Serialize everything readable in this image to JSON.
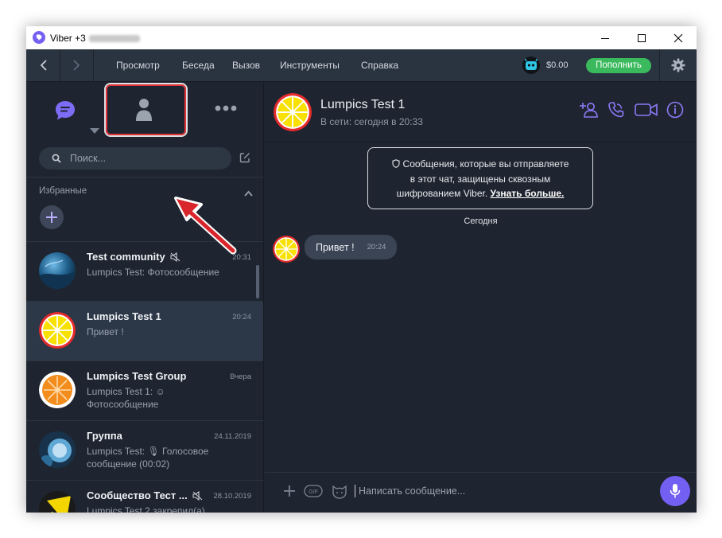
{
  "window": {
    "title": "Viber +3",
    "controls": {
      "minimize": "minimize",
      "maximize": "maximize",
      "close": "close"
    }
  },
  "menubar": {
    "items": [
      "Просмотр",
      "Беседа",
      "Вызов",
      "Инструменты",
      "Справка"
    ],
    "balance": "$0.00",
    "topup_label": "Пополнить"
  },
  "sidebar": {
    "search_placeholder": "Поиск...",
    "favorites_label": "Избранные",
    "chats": [
      {
        "name": "Test community",
        "time": "20:31",
        "preview": "Lumpics Test: Фотосообщение",
        "muted": true,
        "avatar": "community-photo"
      },
      {
        "name": "Lumpics Test 1",
        "time": "20:24",
        "preview": "Привет !",
        "muted": false,
        "avatar": "lemon"
      },
      {
        "name": "Lumpics Test Group",
        "time": "Вчера",
        "preview_line1": "Lumpics Test 1: ☺",
        "preview_line2": "Фотосообщение",
        "muted": false,
        "avatar": "orange"
      },
      {
        "name": "Группа",
        "time": "24.11.2019",
        "preview_line1": "Lumpics Test: 🎙 Голосовое",
        "preview_line2": "сообщение (00:02)",
        "muted": false,
        "avatar": "group-photo"
      },
      {
        "name": "Сообщество Тест ...",
        "time": "28.10.2019",
        "preview": "Lumpics Test 2 закрепил(а)",
        "muted": true,
        "avatar": "community-yellow"
      }
    ]
  },
  "conversation": {
    "name": "Lumpics Test 1",
    "status": "В сети: сегодня в 20:33",
    "e2e_line1": "Сообщения, которые вы отправляете",
    "e2e_line2": "в этот чат, защищены сквозным",
    "e2e_line3_prefix": "шифрованием Viber. ",
    "e2e_link": "Узнать больше.",
    "date_separator": "Сегодня",
    "messages": [
      {
        "text": "Привет !",
        "time": "20:24"
      }
    ],
    "composer_placeholder": "Написать сообщение..."
  },
  "colors": {
    "accent": "#7360f2",
    "topup": "#3aba5d",
    "highlight": "#e0333a",
    "background": "#1f2530"
  }
}
